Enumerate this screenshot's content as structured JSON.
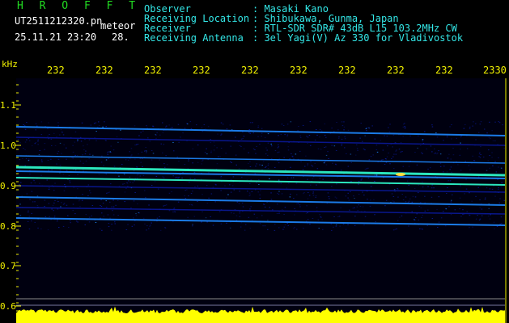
{
  "header": {
    "app_name": "H R O F F T",
    "file_name": "UT2511212320.pn",
    "mode_label": "meteor",
    "datetime": "25.11.21 23:20",
    "count": "28."
  },
  "info": {
    "observer_label": "Observer",
    "observer_value": ": Masaki Kano",
    "location_label": "Receiving Location",
    "location_value": ": Shibukawa, Gunma, Japan",
    "receiver_label": "Receiver",
    "receiver_value": ": RTL-SDR SDR# 43dB L15 103.2MHz CW",
    "antenna_label": "Receiving Antenna",
    "antenna_value": ": 3el Yagi(V) Az 330 for Vladivostok"
  },
  "axis": {
    "y_unit": "kHz",
    "y_ticks": [
      "1.1",
      "1.0",
      "0.9",
      "0.8",
      "0.7",
      "0.6"
    ],
    "x_ticks": [
      "232",
      "232",
      "232",
      "232",
      "232",
      "232",
      "232",
      "232",
      "232",
      "2330"
    ]
  },
  "colors": {
    "background": "#000000",
    "spectro_bg": "#000010",
    "signal_low": "#0a1a9a",
    "signal_mid": "#1e88ff",
    "signal_high": "#30ffd0",
    "signal_peak": "#ffe040",
    "axis_tick": "#f2f200",
    "title_green": "#22dd22",
    "header_cyan": "#33e6e6",
    "baseline_fill": "#ffff00"
  }
}
